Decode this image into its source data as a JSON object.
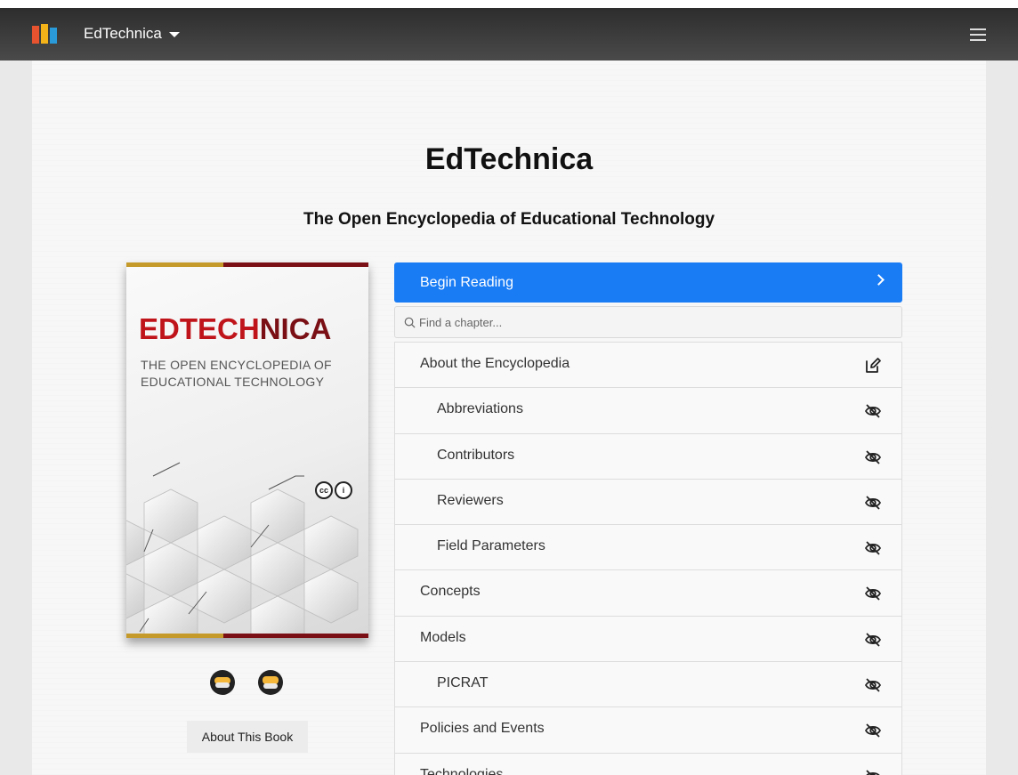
{
  "navbar": {
    "brand": "EdTechnica",
    "logo_colors": [
      "#e8532f",
      "#f5b31a",
      "#f08a1c",
      "#2b9ad8"
    ]
  },
  "header": {
    "title": "EdTechnica",
    "subtitle": "The Open Encyclopedia of Educational Technology"
  },
  "cover": {
    "title_part1": "EDTECH",
    "title_part2": "NICA",
    "subtitle": "THE OPEN ENCYCLOPEDIA OF EDUCATIONAL TECHNOLOGY",
    "license_cc": "cc",
    "license_by": "i"
  },
  "sidebar_actions": {
    "about_label": "About This Book",
    "icons": [
      "users-icon",
      "graduation-cap-icon"
    ]
  },
  "reading": {
    "begin_label": "Begin Reading",
    "search_placeholder": "Find a chapter..."
  },
  "toc": {
    "items": [
      {
        "label": "About the Encyclopedia",
        "indent": false,
        "icon": "edit-icon"
      },
      {
        "label": "Abbreviations",
        "indent": true,
        "icon": "eye-slash-icon"
      },
      {
        "label": "Contributors",
        "indent": true,
        "icon": "eye-slash-icon"
      },
      {
        "label": "Reviewers",
        "indent": true,
        "icon": "eye-slash-icon"
      },
      {
        "label": "Field Parameters",
        "indent": true,
        "icon": "eye-slash-icon"
      },
      {
        "label": "Concepts",
        "indent": false,
        "icon": "eye-slash-icon"
      },
      {
        "label": "Models",
        "indent": false,
        "icon": "eye-slash-icon"
      },
      {
        "label": "PICRAT",
        "indent": true,
        "icon": "eye-slash-icon"
      },
      {
        "label": "Policies and Events",
        "indent": false,
        "icon": "eye-slash-icon"
      },
      {
        "label": "Technologies",
        "indent": false,
        "icon": "eye-slash-icon"
      }
    ]
  },
  "colors": {
    "accent": "#1a7cf5",
    "cover_red": "#c0141b",
    "cover_dark_red": "#7a1015",
    "cover_gold": "#c59a2b"
  }
}
